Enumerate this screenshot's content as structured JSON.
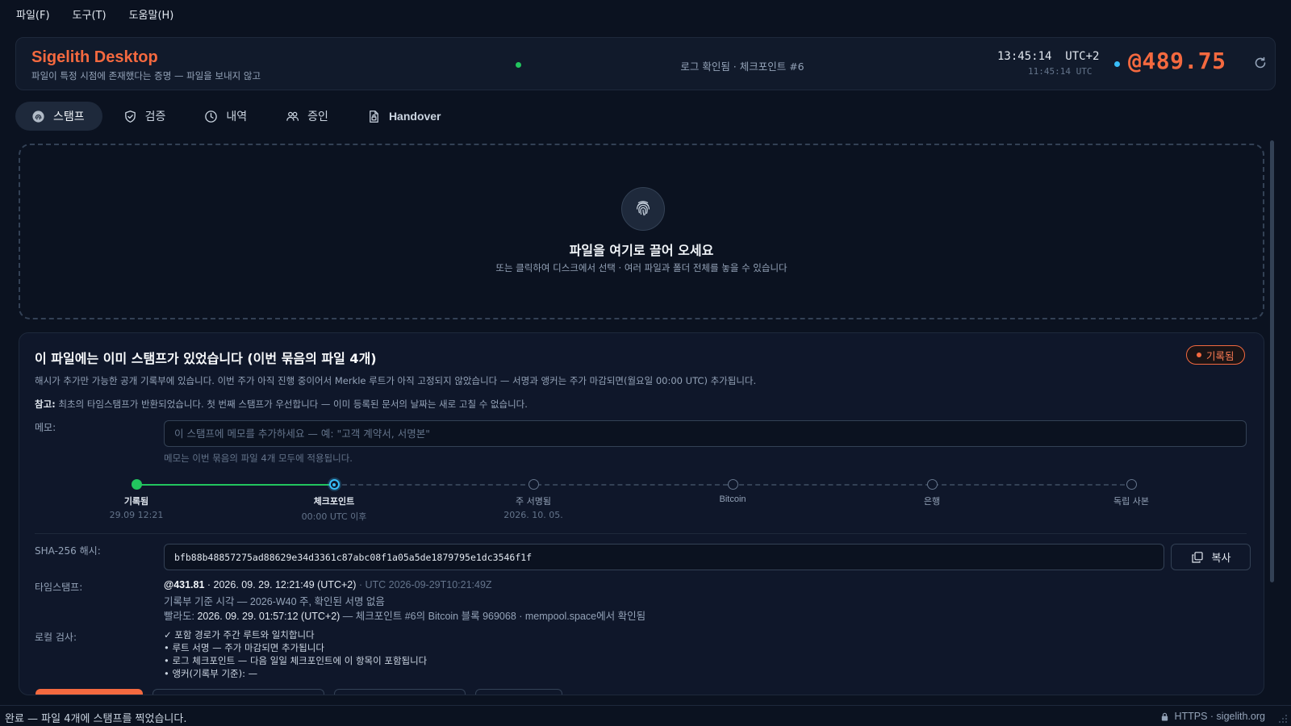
{
  "menu": [
    "파일(F)",
    "도구(T)",
    "도움말(H)"
  ],
  "header": {
    "title": "Sigelith Desktop",
    "subtitle": "파일이 특정 시점에 존재했다는 증명 — 파일을 보내지 않고",
    "status": "로그 확인됨 · 체크포인트 #6",
    "clock": "13:45:14  UTC+2",
    "clock_utc": "11:45:14 UTC",
    "counter": "@489.75"
  },
  "tabs": [
    {
      "label": "스탬프",
      "icon": "fingerprint-icon"
    },
    {
      "label": "검증",
      "icon": "shield-check-icon"
    },
    {
      "label": "내역",
      "icon": "clock-icon"
    },
    {
      "label": "증인",
      "icon": "people-icon"
    },
    {
      "label": "Handover",
      "icon": "document-lock-icon"
    }
  ],
  "dropzone": {
    "title": "파일을 여기로 끌어 오세요",
    "subtitle": "또는 클릭하여 디스크에서 선택 · 여러 파일과 폴더 전체를 놓을 수 있습니다"
  },
  "result": {
    "title": "이 파일에는 이미 스탬프가 있었습니다 (이번 묶음의 파일 4개)",
    "badge": "기록됨",
    "description": "해시가 추가만 가능한 공개 기록부에 있습니다. 이번 주가 아직 진행 중이어서 Merkle 루트가 아직 고정되지 않았습니다 — 서명과 앵커는 주가 마감되면(월요일 00:00 UTC) 추가됩니다.",
    "note_prefix": "참고:",
    "note": " 최초의 타임스탬프가 반환되었습니다. 첫 번째 스탬프가 우선합니다 — 이미 등록된 문서의 날짜는 새로 고칠 수 없습니다.",
    "memo_label": "메모:",
    "memo_value": "",
    "memo_placeholder": "이 스탬프에 메모를 추가하세요 — 예: \"고객 계약서, 서명본\"",
    "memo_help": "메모는 이번 묶음의 파일 4개 모두에 적용됩니다.",
    "steps": [
      {
        "label": "기록됨",
        "sub": "29.09 12:21",
        "state": "done"
      },
      {
        "label": "체크포인트",
        "sub": "00:00 UTC 이후",
        "state": "current"
      },
      {
        "label": "주 서명됨",
        "sub": "2026. 10. 05.",
        "state": "pending"
      },
      {
        "label": "Bitcoin",
        "sub": "",
        "state": "pending"
      },
      {
        "label": "은행",
        "sub": "",
        "state": "pending"
      },
      {
        "label": "독립 사본",
        "sub": "",
        "state": "pending"
      }
    ],
    "hash_label": "SHA-256 해시:",
    "hash": "bfb88b48857275ad88629e34d3361c87abc08f1a05a5de1879795e1dc3546f1f",
    "copy_label": "복사",
    "timestamp_label": "타임스탬프:",
    "ts_at": "@431.81",
    "ts_local": " · 2026. 09. 29. 12:21:49 (UTC+2)",
    "ts_utc": " · UTC 2026-09-29T10:21:49Z",
    "ts_line2": "기록부 기준 시각 — 2026-W40 주, 확인된 서명 없음",
    "ts_line3_prefix": "빨라도: ",
    "ts_line3_date": "2026. 09. 29. 01:57:12 (UTC+2)",
    "ts_line3_rest": " — 체크포인트 #6의 Bitcoin 블록 969068 · mempool.space에서 확인됨",
    "local_check_label": "로컬 검사:",
    "checks": [
      "✓ 포함 경로가 주간 루트와 일치합니다",
      "• 루트 서명 — 주가 마감되면 추가됩니다",
      "• 로그 체크포인트 — 다음 일일 체크포인트에 이 항목이 포함됩니다",
      "• 앵커(기록부 기준): —"
    ]
  },
  "statusbar": {
    "message": "완료 — 파일 4개에 스탬프를 찍었습니다.",
    "connection": "HTTPS · sigelith.org"
  },
  "colors": {
    "accent": "#f4693f",
    "success": "#22c55e",
    "info": "#38bdf8",
    "background": "#0b1220"
  }
}
